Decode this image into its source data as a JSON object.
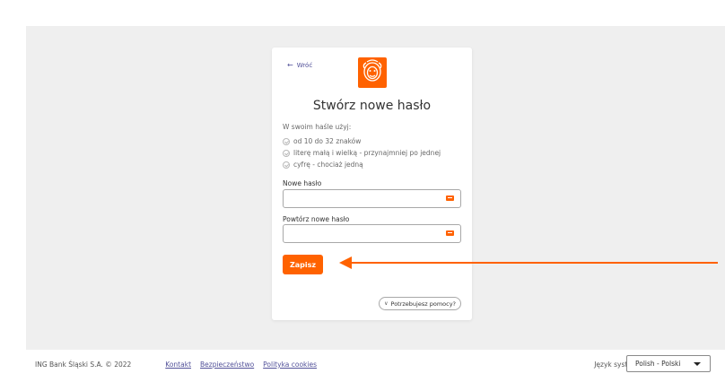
{
  "card": {
    "back_label": "Wróć",
    "title": "Stwórz nowe hasło",
    "rules_intro": "W swoim haśle użyj:",
    "rules": [
      "od 10 do 32 znaków",
      "literę małą i wielką - przynajmniej po jednej",
      "cyfrę - chociaż jedną"
    ],
    "new_password_label": "Nowe hasło",
    "new_password_value": "",
    "repeat_password_label": "Powtórz nowe hasło",
    "repeat_password_value": "",
    "save_label": "Zapisz",
    "help_label": "Potrzebujesz pomocy?"
  },
  "footer": {
    "copyright": "ING Bank Śląski S.A. © 2022",
    "links": [
      "Kontakt",
      "Bezpieczeństwo",
      "Polityka cookies"
    ],
    "language_label": "Język systemu",
    "language_value": "Polish - Polski"
  },
  "colors": {
    "brand": "#ff6200",
    "link": "#525199",
    "background": "#efefef"
  },
  "icons": {
    "back": "arrow-left-icon",
    "logo": "ing-lion-logo",
    "rule_check": "check-circle-icon",
    "keyboard": "virtual-keyboard-icon",
    "help_chevron": "chevron-down-icon",
    "language_caret": "caret-down-icon"
  }
}
